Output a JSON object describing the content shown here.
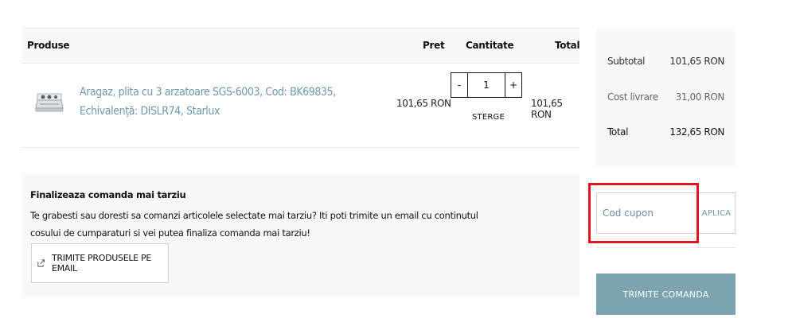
{
  "cart": {
    "headers": {
      "products": "Produse",
      "price": "Pret",
      "quantity": "Cantitate",
      "total": "Total"
    },
    "items": [
      {
        "name": "Aragaz, plita cu 3 arzatoare SGS-6003, Cod: BK69835, Echivalență: DISLR74, Starlux",
        "price": "101,65 RON",
        "quantity": "1",
        "total": "101,65 RON",
        "minus": "-",
        "plus": "+",
        "remove": "STERGE",
        "thumbnail_icon": "gas-stove-icon"
      }
    ]
  },
  "save_for_later": {
    "title": "Finalizeaza comanda mai tarziu",
    "text": "Te grabesti sau doresti sa comanzi articolele selectate mai tarziu? Iti poti trimite un email cu continutul cosului de cumparaturi si vei putea finaliza comanda mai tarziu!",
    "button_label": "TRIMITE PRODUSELE PE EMAIL",
    "button_icon": "share-icon"
  },
  "summary": {
    "subtotal_label": "Subtotal",
    "subtotal_value": "101,65 RON",
    "shipping_label": "Cost livrare",
    "shipping_value": "31,00 RON",
    "total_label": "Total",
    "total_value": "132,65 RON"
  },
  "coupon": {
    "placeholder": "Cod cupon",
    "value": "",
    "apply_label": "APLICA"
  },
  "submit_label": "TRIMITE COMANDA",
  "colors": {
    "accent": "#7ba3b0",
    "link": "#6f98a8",
    "panel_bg": "#f7f8f9",
    "highlight": "#e0161e"
  }
}
